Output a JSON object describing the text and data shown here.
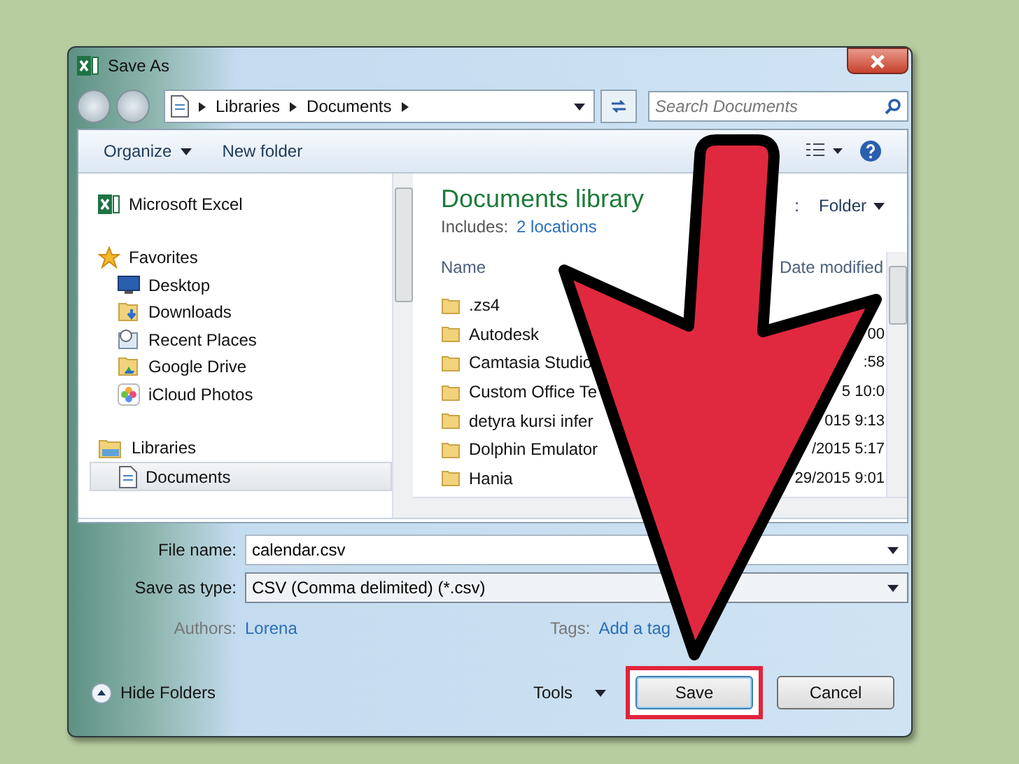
{
  "window": {
    "title": "Save As"
  },
  "address": {
    "crumbs": [
      "Libraries",
      "Documents"
    ]
  },
  "search": {
    "placeholder": "Search Documents"
  },
  "toolbar": {
    "organize": "Organize",
    "new_folder": "New folder"
  },
  "nav": [
    {
      "label": "Microsoft Excel",
      "kind": "excel",
      "selected": false
    },
    {
      "label": "Favorites",
      "kind": "star",
      "selected": false,
      "children": [
        {
          "label": "Desktop",
          "kind": "desktop",
          "selected": false
        },
        {
          "label": "Downloads",
          "kind": "downloads",
          "selected": false
        },
        {
          "label": "Recent Places",
          "kind": "recent",
          "selected": false
        },
        {
          "label": "Google Drive",
          "kind": "drive",
          "selected": false
        },
        {
          "label": "iCloud Photos",
          "kind": "photos",
          "selected": false
        }
      ]
    },
    {
      "label": "Libraries",
      "kind": "libraries",
      "selected": false,
      "children": [
        {
          "label": "Documents",
          "kind": "document",
          "selected": true
        }
      ]
    }
  ],
  "library": {
    "title": "Documents library",
    "includes_label": "Includes:",
    "includes_link": "2 locations",
    "arrange_tail": ":",
    "arrange_value": "Folder"
  },
  "table": {
    "columns": [
      "Name",
      "Date modified"
    ],
    "rows": [
      {
        "name": ".zs4"
      },
      {
        "name": "Autodesk",
        "date": "00"
      },
      {
        "name": "Camtasia Studio",
        "date": ":58"
      },
      {
        "name": "Custom Office Te",
        "date": "5 10:0"
      },
      {
        "name": "detyra kursi infer",
        "date": "015 9:13"
      },
      {
        "name": "Dolphin Emulator",
        "date": "/2015 5:17"
      },
      {
        "name": "Hania",
        "date": "29/2015 9:01"
      }
    ]
  },
  "form": {
    "file_name_label": "File name:",
    "file_name": "calendar.csv",
    "type_label": "Save as type:",
    "type_value": "CSV (Comma delimited) (*.csv)",
    "authors_label": "Authors:",
    "authors_value": "Lorena",
    "tags_label": "Tags:",
    "tags_value": "Add a tag"
  },
  "footer": {
    "hide_folders": "Hide Folders",
    "tools": "Tools",
    "save": "Save",
    "cancel": "Cancel"
  }
}
